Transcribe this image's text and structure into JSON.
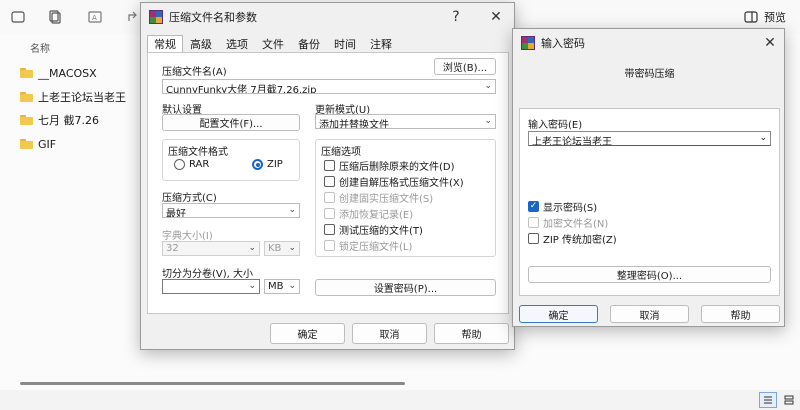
{
  "explorer": {
    "toolbar_icons": [
      "new-icon",
      "copy-icon",
      "rename-icon",
      "share-icon"
    ],
    "preview_label": "预览",
    "column_name": "名称",
    "items": [
      "__MACOSX",
      "上老王论坛当老王",
      "七月 截7.26",
      "GIF"
    ]
  },
  "archive_dialog": {
    "title": "压缩文件名和参数",
    "help_glyph": "?",
    "close_glyph": "✕",
    "tabs": [
      "常规",
      "高级",
      "选项",
      "文件",
      "备份",
      "时间",
      "注释"
    ],
    "active_tab": "常规",
    "archive_name_label": "压缩文件名(A)",
    "browse_button": "浏览(B)...",
    "archive_name_value": "CunnyFunky大佬 7月截7.26.zip",
    "default_settings_label": "默认设置",
    "profiles_button": "配置文件(F)...",
    "update_mode_label": "更新模式(U)",
    "update_mode_value": "添加并替换文件",
    "format_group_label": "压缩文件格式",
    "format_rar": "RAR",
    "format_zip": "ZIP",
    "format_selected": "ZIP",
    "options_group_label": "压缩选项",
    "options": [
      {
        "label": "压缩后删除原来的文件(D)",
        "checked": false,
        "disabled": false
      },
      {
        "label": "创建自解压格式压缩文件(X)",
        "checked": false,
        "disabled": false
      },
      {
        "label": "创建固实压缩文件(S)",
        "checked": false,
        "disabled": true
      },
      {
        "label": "添加恢复记录(E)",
        "checked": false,
        "disabled": true
      },
      {
        "label": "测试压缩的文件(T)",
        "checked": false,
        "disabled": false
      },
      {
        "label": "锁定压缩文件(L)",
        "checked": false,
        "disabled": true
      }
    ],
    "method_label": "压缩方式(C)",
    "method_value": "最好",
    "dict_label": "字典大小(I)",
    "dict_value": "32",
    "dict_unit": "KB",
    "split_label": "切分为分卷(V), 大小",
    "split_value": "",
    "split_unit": "MB",
    "set_password_button": "设置密码(P)...",
    "ok_button": "确定",
    "cancel_button": "取消",
    "help_button": "帮助"
  },
  "password_dialog": {
    "title": "输入密码",
    "close_glyph": "✕",
    "subtitle": "带密码压缩",
    "password_label": "输入密码(E)",
    "password_value": "上老王论坛当老王",
    "show_password": {
      "label": "显示密码(S)",
      "checked": true,
      "disabled": false
    },
    "encrypt_names": {
      "label": "加密文件名(N)",
      "checked": false,
      "disabled": true
    },
    "zip_legacy": {
      "label": "ZIP 传统加密(Z)",
      "checked": false,
      "disabled": false
    },
    "organize_button": "整理密码(O)...",
    "ok_button": "确定",
    "cancel_button": "取消",
    "help_button": "帮助"
  },
  "colors": {
    "accent": "#1b64c8",
    "folder": "#f2c94c",
    "dialog_bg": "#f0f0f0"
  }
}
